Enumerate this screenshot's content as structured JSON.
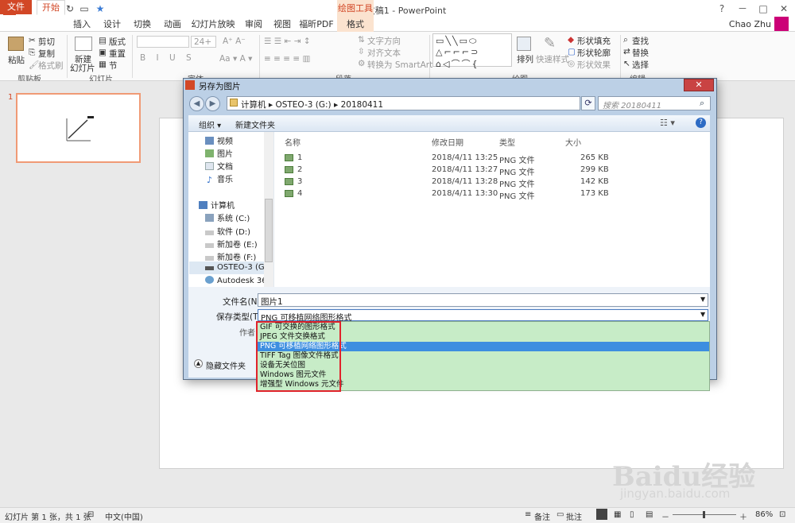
{
  "window": {
    "title": "演示文稿1 - PowerPoint",
    "context_tab_group": "绘图工具",
    "user": "Chao Zhu",
    "minimize": "－",
    "restore": "□",
    "close": "✕",
    "help": "?"
  },
  "tabs": [
    "文件",
    "开始",
    "插入",
    "设计",
    "切换",
    "动画",
    "幻灯片放映",
    "审阅",
    "视图",
    "福昕PDF",
    "格式"
  ],
  "ribbon": {
    "clipboard": {
      "paste": "粘贴",
      "cut": "剪切",
      "copy": "复制",
      "painter": "格式刷",
      "label": "剪贴板"
    },
    "slides": {
      "new": "新建",
      "new2": "幻灯片",
      "layout": "版式",
      "reset": "重置",
      "section": "节",
      "label": "幻灯片"
    },
    "font": {
      "size": "24+",
      "label": "字体"
    },
    "paragraph": {
      "direction": "文字方向",
      "align": "对齐文本",
      "smartart": "转换为 SmartArt",
      "label": "段落"
    },
    "drawing": {
      "arrange": "排列",
      "quickstyles": "快速样式",
      "fill": "形状填充",
      "outline": "形状轮廓",
      "effects": "形状效果",
      "label": "绘图"
    },
    "editing": {
      "find": "查找",
      "replace": "替换",
      "select": "选择",
      "label": "编辑"
    }
  },
  "slide_panel": {
    "number": "1"
  },
  "dialog": {
    "title": "另存为图片",
    "breadcrumb": "计算机  ▸  OSTEO-3 (G:)  ▸  20180411",
    "search_placeholder": "搜索 20180411",
    "organize": "组织 ▾",
    "new_folder": "新建文件夹",
    "nav": {
      "favorites": [
        "视频",
        "图片",
        "文档",
        "音乐"
      ],
      "computer": "计算机",
      "drives": [
        "系统 (C:)",
        "软件 (D:)",
        "新加卷 (E:)",
        "新加卷 (F:)",
        "OSTEO-3 (G:)",
        "Autodesk 360"
      ]
    },
    "columns": {
      "name": "名称",
      "date": "修改日期",
      "type": "类型",
      "size": "大小"
    },
    "files": [
      {
        "name": "1",
        "date": "2018/4/11 13:25",
        "type": "PNG 文件",
        "size": "265 KB"
      },
      {
        "name": "2",
        "date": "2018/4/11 13:27",
        "type": "PNG 文件",
        "size": "299 KB"
      },
      {
        "name": "3",
        "date": "2018/4/11 13:28",
        "type": "PNG 文件",
        "size": "142 KB"
      },
      {
        "name": "4",
        "date": "2018/4/11 13:30",
        "type": "PNG 文件",
        "size": "173 KB"
      }
    ],
    "filename_label": "文件名(N):",
    "filename_value": "图片1",
    "filetype_label": "保存类型(T):",
    "filetype_value": "PNG 可移植网络图形格式",
    "author_label": "作者:",
    "hide_folders": "隐藏文件夹",
    "filetype_options": [
      "GIF 可交换的图形格式",
      "JPEG 文件交换格式",
      "PNG 可移植网络图形格式",
      "TIFF Tag 图像文件格式",
      "设备无关位图",
      "Windows 图元文件",
      "增强型 Windows 元文件"
    ]
  },
  "status": {
    "slide": "幻灯片 第 1 张，共 1 张",
    "language": "中文(中国)",
    "notes": "备注",
    "comments": "批注",
    "zoom": "86%"
  },
  "watermark": {
    "text": "Baidu经验",
    "url": "jingyan.baidu.com"
  },
  "colors": {
    "accent": "#d24726",
    "dropdown_bg": "#c7ecc7",
    "selected": "#3d8ee0",
    "highlight_box": "#e0232b"
  }
}
